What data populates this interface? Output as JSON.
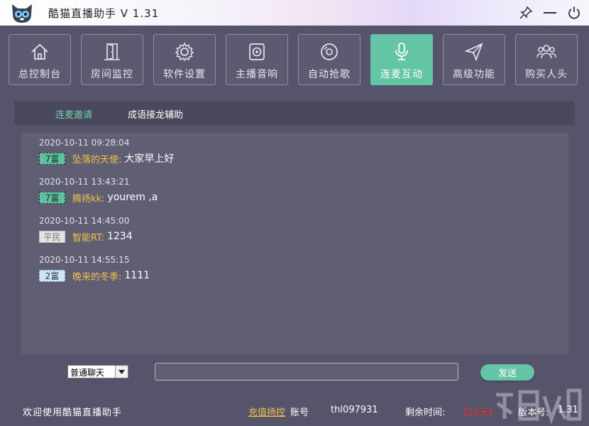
{
  "window": {
    "title": "酷猫直播助手 V 1.31"
  },
  "toolbar": {
    "items": [
      {
        "label": "总控制台",
        "icon": "home-icon"
      },
      {
        "label": "房间监控",
        "icon": "door-icon"
      },
      {
        "label": "软件设置",
        "icon": "gear-icon"
      },
      {
        "label": "主播音响",
        "icon": "speaker-icon"
      },
      {
        "label": "自动抢歌",
        "icon": "disc-icon"
      },
      {
        "label": "连麦互动",
        "icon": "microphone-icon",
        "active": true
      },
      {
        "label": "高级功能",
        "icon": "send-icon"
      },
      {
        "label": "购买人头",
        "icon": "users-icon"
      }
    ]
  },
  "tabs": {
    "invite": "连麦邀请",
    "idiom": "成语接龙辅助"
  },
  "messages": [
    {
      "time": "2020-10-11 09:28:04",
      "badge": "7富",
      "user": "坠落的天使:",
      "text": "大家早上好"
    },
    {
      "time": "2020-10-11 13:43:21",
      "badge": "7富",
      "user": "腾扬kk:",
      "text": "yourem ,a"
    },
    {
      "time": "2020-10-11 14:45:00",
      "badge": "平民",
      "user": "智能RT:",
      "text": "1234"
    },
    {
      "time": "2020-10-11 14:55:15",
      "badge": "2富",
      "user": "晚来的冬季:",
      "text": "1111"
    }
  ],
  "composer": {
    "chat_type": "普通聊天",
    "send_label": "发送",
    "input_value": ""
  },
  "status": {
    "welcome": "欢迎使用酷猫直播助手",
    "recharge": "充值扬控",
    "account_label": "账号",
    "account": "thl097931",
    "remaining_label": "剩余时间:",
    "remaining": "【29天】",
    "version_label": "版本号:",
    "version": "1.31"
  },
  "colors": {
    "accent": "#63c4a6",
    "username": "#f3c14a",
    "remaining": "#e0322a",
    "background": "#55546a"
  }
}
